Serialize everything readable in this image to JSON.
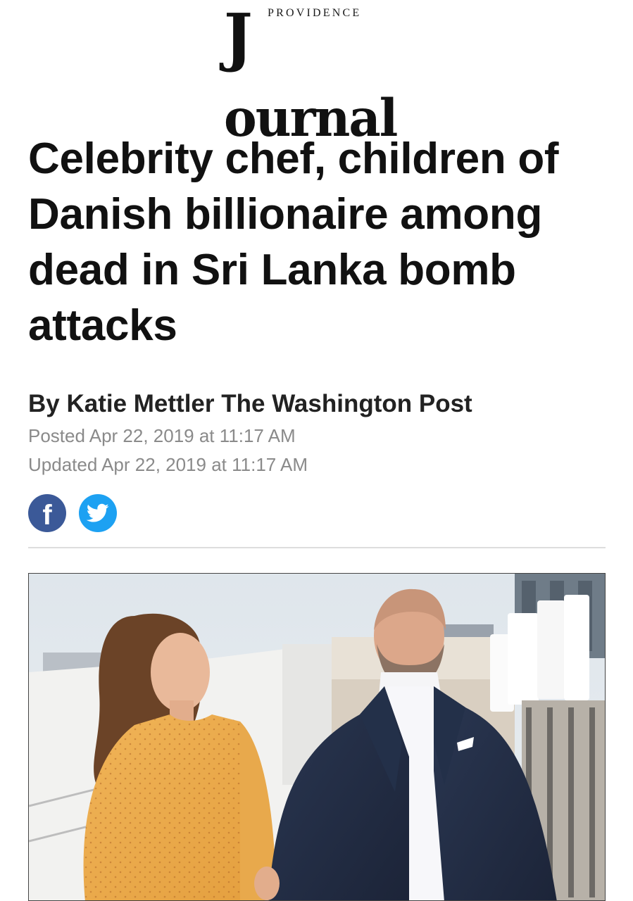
{
  "masthead": {
    "small_word": "PROVIDENCE",
    "big_word": "Journal"
  },
  "article": {
    "headline": "Celebrity chef, children of Danish billionaire among dead in Sri Lanka bomb attacks",
    "byline": "By Katie Mettler The Washington Post",
    "posted": "Posted Apr 22, 2019 at 11:17 AM",
    "updated": "Updated Apr 22, 2019 at 11:17 AM"
  },
  "share": {
    "facebook_icon": "facebook-icon",
    "twitter_icon": "twitter-icon"
  },
  "colors": {
    "facebook": "#3b5998",
    "twitter": "#1da1f2",
    "meta_gray": "#8a8a8a",
    "divider": "#dddddd"
  }
}
